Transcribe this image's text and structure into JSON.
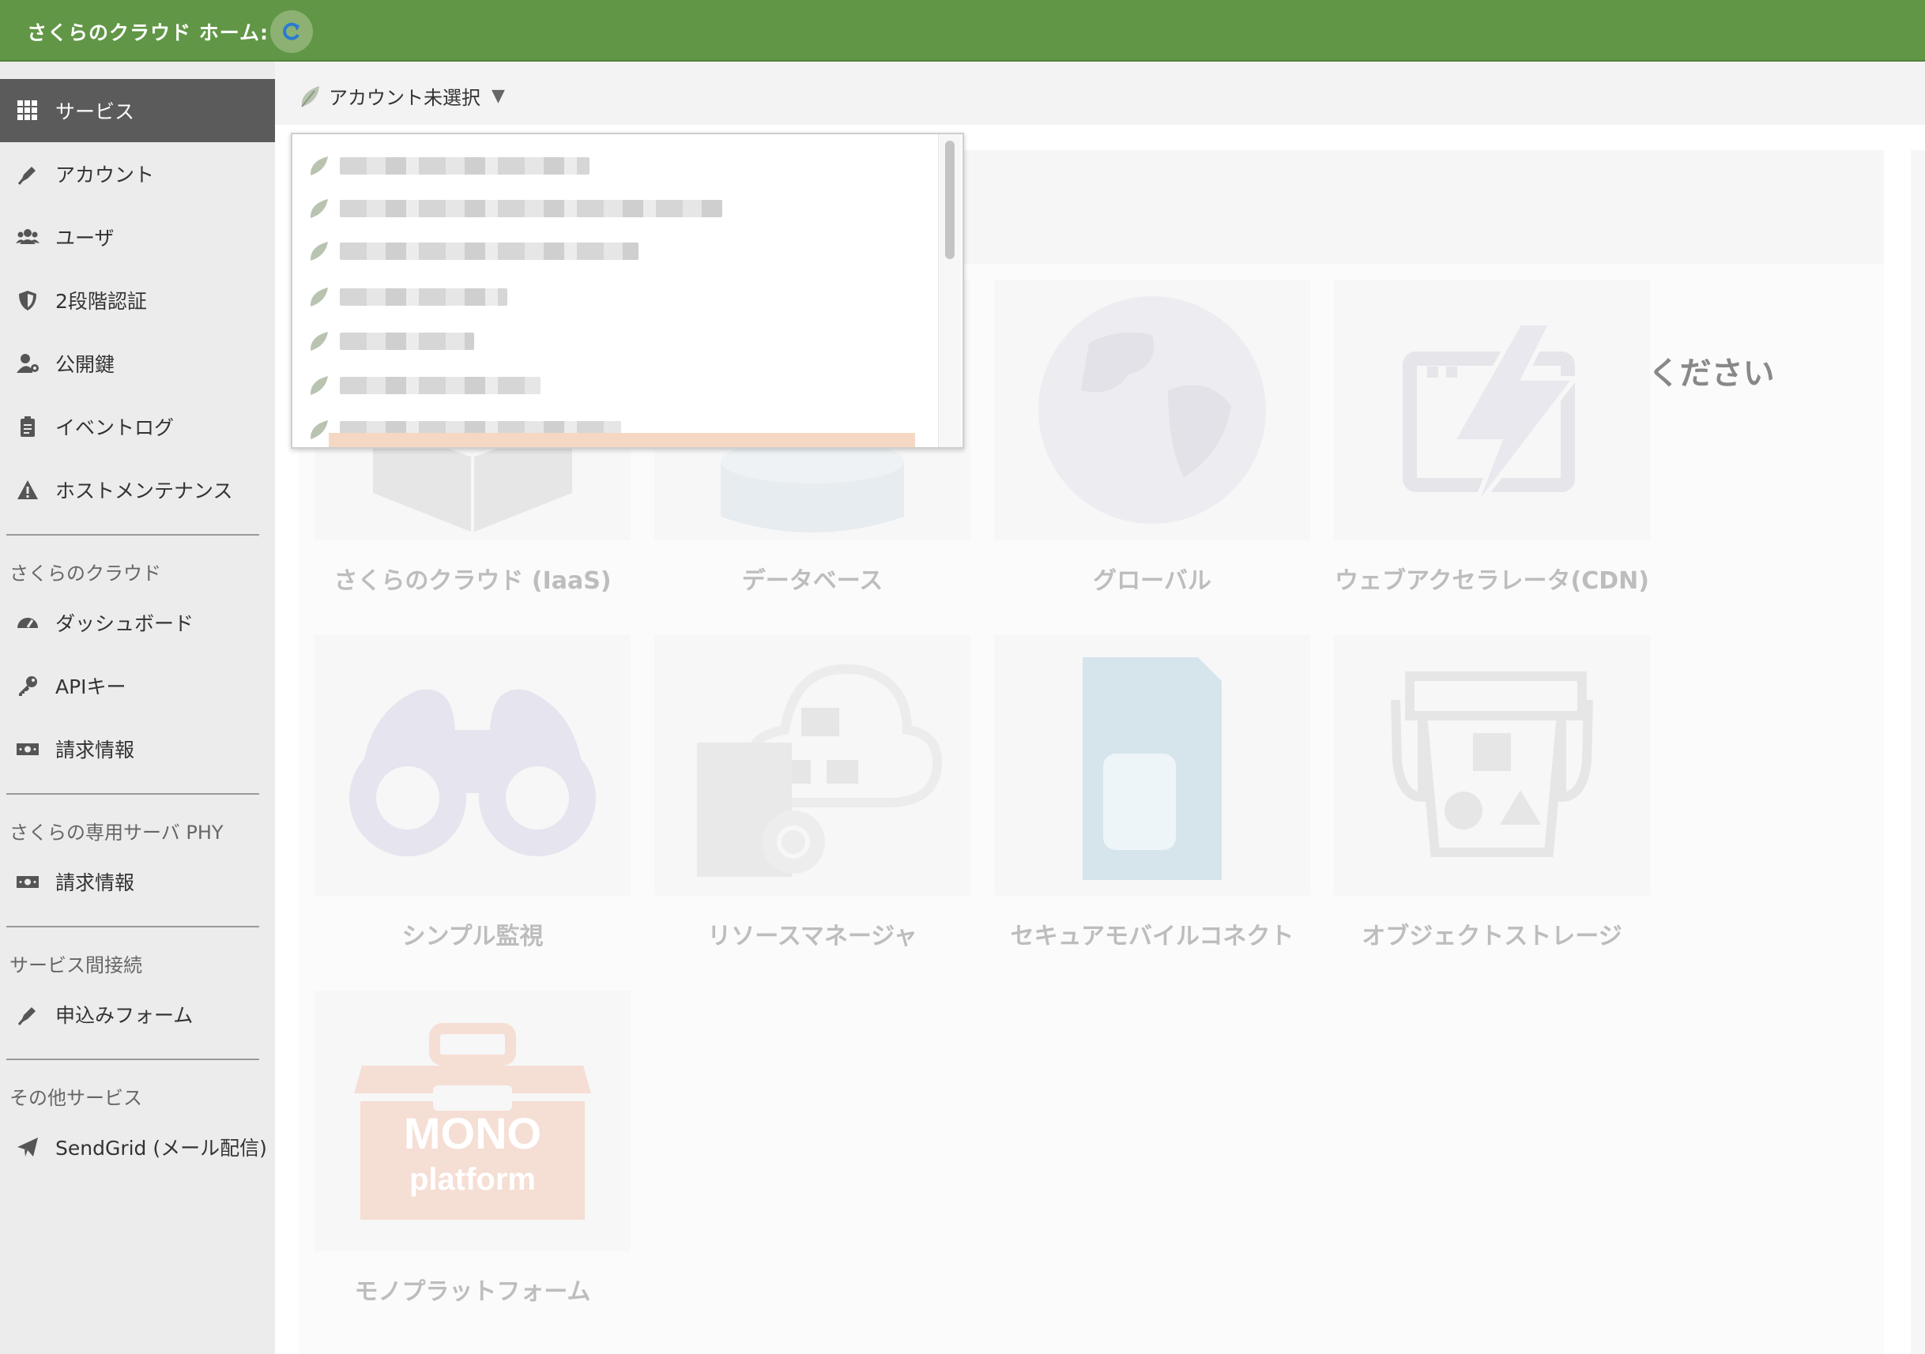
{
  "header": {
    "title": "さくらのクラウド ホーム:",
    "refresh_icon": "refresh-icon"
  },
  "sidebar": {
    "items": [
      {
        "label": "サービス",
        "icon": "grid-icon",
        "active": true
      },
      {
        "label": "アカウント",
        "icon": "pen-icon"
      },
      {
        "label": "ユーザ",
        "icon": "users-icon"
      },
      {
        "label": "2段階認証",
        "icon": "shield-icon"
      },
      {
        "label": "公開鍵",
        "icon": "user-key-icon"
      },
      {
        "label": "イベントログ",
        "icon": "clipboard-icon"
      },
      {
        "label": "ホストメンテナンス",
        "icon": "warning-icon"
      }
    ],
    "sections": [
      {
        "title": "さくらのクラウド",
        "items": [
          {
            "label": "ダッシュボード",
            "icon": "gauge-icon"
          },
          {
            "label": "APIキー",
            "icon": "key-icon"
          },
          {
            "label": "請求情報",
            "icon": "money-icon"
          }
        ]
      },
      {
        "title": "さくらの専用サーバ PHY",
        "items": [
          {
            "label": "請求情報",
            "icon": "money-icon"
          }
        ]
      },
      {
        "title": "サービス間接続",
        "items": [
          {
            "label": "申込みフォーム",
            "icon": "pen-icon"
          }
        ]
      },
      {
        "title": "その他サービス",
        "items": [
          {
            "label": "SendGrid (メール配信)",
            "icon": "paper-plane-icon"
          }
        ]
      }
    ]
  },
  "account": {
    "selector_label": "アカウント未選択",
    "prompt": "アカウントを選択してください"
  },
  "services": [
    {
      "label": "さくらのクラウド (IaaS)",
      "icon": "box-icon"
    },
    {
      "label": "データベース",
      "icon": "database-icon"
    },
    {
      "label": "グローバル",
      "icon": "globe-icon"
    },
    {
      "label": "ウェブアクセラレータ(CDN)",
      "icon": "lightning-icon"
    },
    {
      "label": "シンプル監視",
      "icon": "binoculars-icon"
    },
    {
      "label": "リソースマネージャ",
      "icon": "cloud-code-icon"
    },
    {
      "label": "セキュアモバイルコネクト",
      "icon": "sim-card-icon"
    },
    {
      "label": "オブジェクトストレージ",
      "icon": "bucket-icon"
    },
    {
      "label": "モノプラットフォーム",
      "icon": "toolbox-icon",
      "logo_line1": "MONO",
      "logo_line2": "platform"
    }
  ],
  "colors": {
    "header": "#619646",
    "sidebar_active": "#5b5b5b",
    "sidebar_bg": "#ececec"
  }
}
